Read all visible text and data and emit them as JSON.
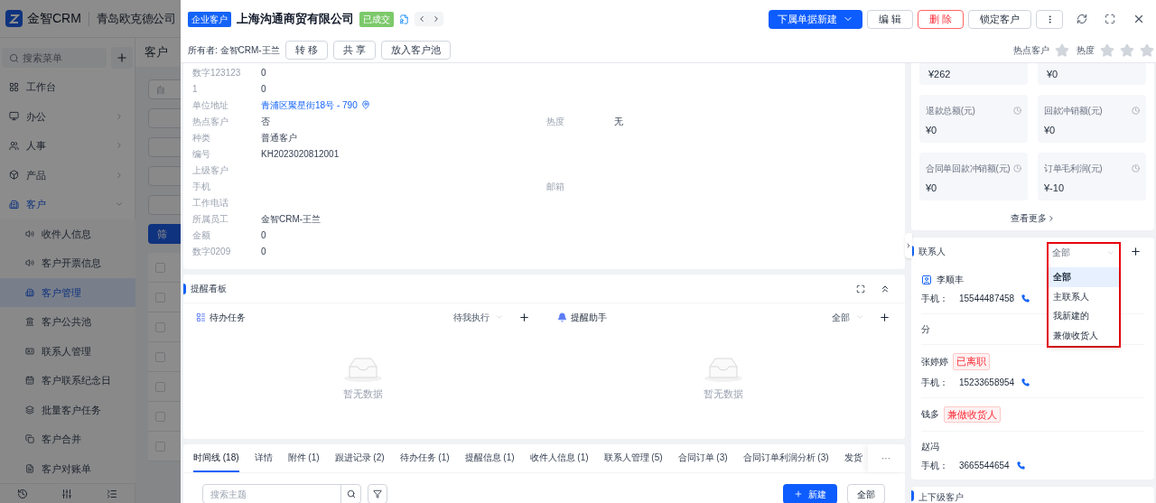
{
  "background_app": {
    "brand": "金智CRM",
    "company": "青岛欧克德公司",
    "menu_search": {
      "placeholder": "搜索菜单"
    },
    "page_title": "客户",
    "filter_placeholder": "自",
    "filter_button": "筛",
    "table_rows": [
      {
        "checked": false
      },
      {
        "checked": false
      },
      {
        "checked": false
      },
      {
        "checked": false
      },
      {
        "checked": false
      },
      {
        "checked": false
      },
      {
        "checked": false
      }
    ],
    "menu": [
      {
        "label": "工作台",
        "kind": "link",
        "selected": false
      },
      {
        "label": "办公",
        "kind": "group",
        "expanded": false,
        "selected": false
      },
      {
        "label": "人事",
        "kind": "group",
        "expanded": false,
        "selected": false
      },
      {
        "label": "产品",
        "kind": "group",
        "expanded": false,
        "selected": false
      },
      {
        "label": "客户",
        "kind": "group",
        "expanded": true,
        "selected": true,
        "children": [
          {
            "label": "收件人信息",
            "selected": false
          },
          {
            "label": "客户开票信息",
            "selected": false
          },
          {
            "label": "客户管理",
            "selected": true
          },
          {
            "label": "客户公共池",
            "selected": false
          },
          {
            "label": "联系人管理",
            "selected": false
          },
          {
            "label": "客户联系纪念日",
            "selected": false
          },
          {
            "label": "批量客户任务",
            "selected": false
          },
          {
            "label": "客户合并",
            "selected": false
          },
          {
            "label": "客户对账单",
            "selected": false
          }
        ]
      }
    ]
  },
  "drawer": {
    "type_badge": "企业客户",
    "title": "上海沟通商贸有限公司",
    "status_tag": "已成交",
    "actions": {
      "primary": "下属单据新建",
      "edit": "编 辑",
      "delete": "删 除",
      "lock": "锁定客户"
    },
    "owner": "所有者: 金智CRM-王兰",
    "owner_buttons": [
      "转 移",
      "共 享",
      "放入客户池"
    ],
    "hot_customer": {
      "label": "热点客户",
      "on": false
    },
    "heat": {
      "label": "热度",
      "stars": 0
    },
    "details": [
      {
        "label": "数字123123",
        "value": "0"
      },
      {
        "label": "1",
        "value": "0"
      },
      {
        "label": "单位地址",
        "value": "青浦区聚星街18号 - 790",
        "kind": "address"
      },
      {
        "label": "热点客户",
        "value": "否",
        "right_label": "热度",
        "right_value": "无"
      },
      {
        "label": "种类",
        "value": "普通客户"
      },
      {
        "label": "编号",
        "value": "KH2023020812001"
      },
      {
        "label": "上级客户"
      },
      {
        "label": "手机",
        "right_label": "邮箱"
      },
      {
        "label": "工作电话"
      },
      {
        "label": "所属员工",
        "value": "金智CRM-王兰"
      },
      {
        "label": "金额",
        "value": "0"
      },
      {
        "label": "数字0209",
        "value": "0"
      }
    ],
    "reminder_board": {
      "title": "提醒看板",
      "tasks": {
        "title": "待办任务",
        "filter": "待我执行",
        "empty": "暂无数据"
      },
      "assistant": {
        "title": "提醒助手",
        "filter": "全部",
        "empty": "暂无数据"
      }
    },
    "tabs": [
      {
        "label": "时间线 (18)",
        "selected": true
      },
      {
        "label": "详情",
        "selected": false
      },
      {
        "label": "附件 (1)",
        "selected": false
      },
      {
        "label": "跟进记录 (2)",
        "selected": false
      },
      {
        "label": "待办任务 (1)",
        "selected": false
      },
      {
        "label": "提醒信息 (1)",
        "selected": false
      },
      {
        "label": "收件人信息 (1)",
        "selected": false
      },
      {
        "label": "联系人管理 (5)",
        "selected": false
      },
      {
        "label": "合同订单 (3)",
        "selected": false
      },
      {
        "label": "合同订单利润分析 (3)",
        "selected": false
      },
      {
        "label": "发货",
        "selected": false
      }
    ],
    "more_tabs": "···",
    "timeline_toolbar": {
      "search_placeholder": "搜索主题",
      "new_button": "新建",
      "filter": "全部"
    },
    "stats_top": [
      "¥262",
      "¥0"
    ],
    "stats": [
      {
        "label": "退款总额(元)",
        "value": "¥0"
      },
      {
        "label": "回款冲销额(元)",
        "value": "¥0"
      },
      {
        "label": "合同单回款冲销额(元)",
        "value": "¥0"
      },
      {
        "label": "订单毛利润(元)",
        "value": "¥-10"
      }
    ],
    "see_more": "查看更多",
    "contacts": {
      "title": "联系人",
      "filter": "全部",
      "options": [
        {
          "label": "全部",
          "selected": true
        },
        {
          "label": "主联系人",
          "selected": false
        },
        {
          "label": "我新建的",
          "selected": false
        },
        {
          "label": "兼做收货人",
          "selected": false
        }
      ],
      "items": [
        {
          "name": "李顺丰",
          "primary": true,
          "phone_label": "手机：",
          "phone": "15544487458"
        },
        {
          "name": "分",
          "primary": false
        },
        {
          "name": "张婷婷",
          "primary": false,
          "tag": "已离职",
          "phone_label": "手机：",
          "phone": "15233658954"
        },
        {
          "name": "钱多",
          "primary": false,
          "tag": "兼做收货人"
        },
        {
          "name": "赵冯",
          "primary": false,
          "phone_label": "手机：",
          "phone": "3665544654"
        }
      ]
    },
    "hierarchy_title": "上下级客户"
  }
}
